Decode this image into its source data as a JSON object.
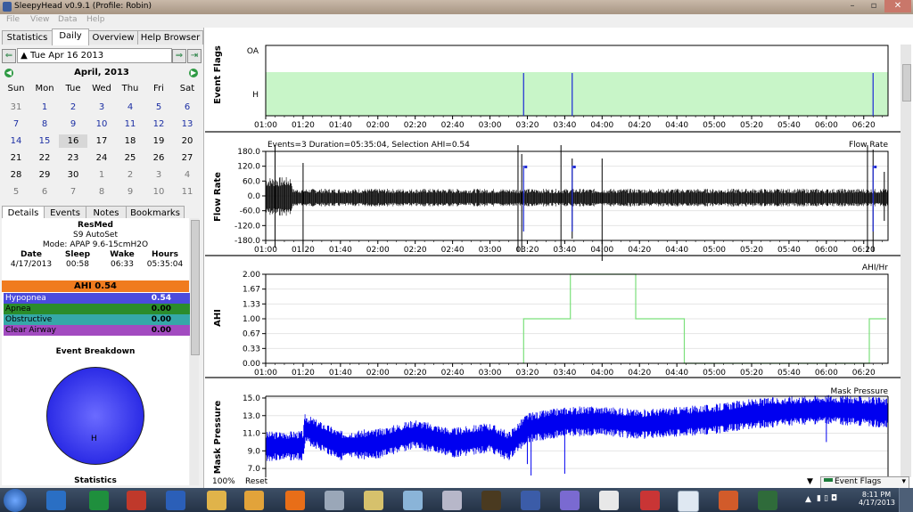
{
  "window": {
    "title": "SleepyHead v0.9.1  (Profile: Robin)",
    "buttons": [
      "–",
      "▫",
      "✕"
    ]
  },
  "menu": [
    "File",
    "View",
    "Data",
    "Help"
  ],
  "tabs": [
    "Statistics",
    "Daily",
    "Overview",
    "Help Browser"
  ],
  "active_tab": "Daily",
  "date_field": "Tue Apr 16 2013",
  "calendar": {
    "month_label": "April,  2013",
    "weekdays": [
      "Sun",
      "Mon",
      "Tue",
      "Wed",
      "Thu",
      "Fri",
      "Sat"
    ],
    "weeks": [
      [
        "31",
        "1",
        "2",
        "3",
        "4",
        "5",
        "6"
      ],
      [
        "7",
        "8",
        "9",
        "10",
        "11",
        "12",
        "13"
      ],
      [
        "14",
        "15",
        "16",
        "17",
        "18",
        "19",
        "20"
      ],
      [
        "21",
        "22",
        "23",
        "24",
        "25",
        "26",
        "27"
      ],
      [
        "28",
        "29",
        "30",
        "1",
        "2",
        "3",
        "4"
      ],
      [
        "5",
        "6",
        "7",
        "8",
        "9",
        "10",
        "11"
      ]
    ],
    "selected": "16"
  },
  "sub_tabs": [
    "Details",
    "Events",
    "Notes",
    "Bookmarks"
  ],
  "device": {
    "brand": "ResMed",
    "model": "S9 AutoSet",
    "mode": "Mode: APAP 9.6-15cmH2O"
  },
  "session_table": {
    "headers": [
      "Date",
      "Sleep",
      "Wake",
      "Hours"
    ],
    "values": [
      "4/17/2013",
      "00:58",
      "06:33",
      "05:35:04"
    ]
  },
  "ahi_header": "AHI 0.54",
  "event_rows": [
    {
      "name": "Hypopnea",
      "value": "0.54",
      "color": "#4b4bdc"
    },
    {
      "name": "Apnea",
      "value": "0.00",
      "color": "#2b8c2b"
    },
    {
      "name": "Obstructive",
      "value": "0.00",
      "color": "#35a8a8"
    },
    {
      "name": "Clear Airway",
      "value": "0.00",
      "color": "#a24bc0"
    }
  ],
  "event_breakdown_title": "Event Breakdown",
  "pie_label": "H",
  "statistics_label": "Statistics",
  "time_ticks": [
    "01:00",
    "01:20",
    "01:40",
    "02:00",
    "02:20",
    "02:40",
    "03:00",
    "03:20",
    "03:40",
    "04:00",
    "04:20",
    "04:40",
    "05:00",
    "05:20",
    "05:40",
    "06:00",
    "06:20"
  ],
  "event_flags": {
    "ylabel": "Event Flags",
    "rows": [
      "OA",
      "H"
    ],
    "h_event_times": [
      "03:18",
      "03:44",
      "06:25"
    ]
  },
  "flow_rate": {
    "ylabel": "Flow Rate",
    "legend": "Flow Rate",
    "summary": "Events=3 Duration=05:35:04, Selection AHI=0.54",
    "yticks": [
      "180.0",
      "120.0",
      "60.0",
      "0.0",
      "-60.0",
      "-120.0",
      "-180.0"
    ]
  },
  "ahi_chart": {
    "ylabel": "AHI",
    "legend": "AHI/Hr",
    "yticks": [
      "2.00",
      "1.67",
      "1.33",
      "1.00",
      "0.67",
      "0.33",
      "0.00"
    ]
  },
  "mask_pressure": {
    "ylabel": "Mask Pressure",
    "legend": "Mask Pressure",
    "yticks": [
      "15.0",
      "13.0",
      "11.0",
      "9.0",
      "7.0"
    ]
  },
  "chart_data": [
    {
      "type": "line",
      "title": "AHI/Hr",
      "ylabel": "AHI",
      "ylim": [
        0,
        2
      ],
      "x": [
        "03:18",
        "03:18",
        "03:43",
        "03:43",
        "04:18",
        "04:18",
        "04:44",
        "04:44",
        "06:23",
        "06:23",
        "06:32"
      ],
      "values": [
        0,
        1,
        1,
        2,
        2,
        1,
        1,
        0,
        0,
        1,
        1
      ],
      "color": "#7be07b"
    },
    {
      "type": "line",
      "title": "Mask Pressure",
      "ylabel": "Mask Pressure",
      "ylim": [
        7,
        15
      ],
      "x": [
        "01:00",
        "01:20",
        "01:21",
        "01:40",
        "02:00",
        "02:20",
        "02:40",
        "03:00",
        "03:10",
        "03:20",
        "03:40",
        "04:00",
        "04:20",
        "05:00",
        "05:20",
        "05:40",
        "06:00",
        "06:20",
        "06:32"
      ],
      "values": [
        9.5,
        9.6,
        11.5,
        9.6,
        9.8,
        10.9,
        9.9,
        10.5,
        9.5,
        11.6,
        12.3,
        12.4,
        12.0,
        12.6,
        13.2,
        13.5,
        13.7,
        13.5,
        13.3
      ],
      "color": "#0000f0"
    }
  ],
  "status": {
    "zoom": "100%",
    "reset": "Reset",
    "dropdown": "Event Flags"
  },
  "taskbar": {
    "time": "8:11 PM",
    "date": "4/17/2013"
  }
}
